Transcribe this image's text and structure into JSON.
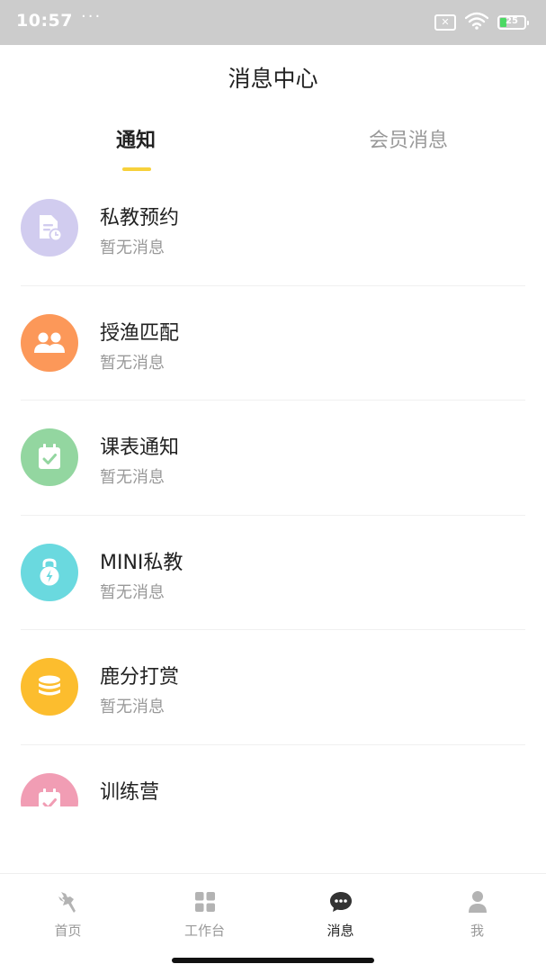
{
  "status_bar": {
    "time": "10:57",
    "dots": "···",
    "battery_level": "25"
  },
  "header": {
    "title": "消息中心"
  },
  "tabs": [
    {
      "label": "通知",
      "active": true
    },
    {
      "label": "会员消息",
      "active": false
    }
  ],
  "messages": [
    {
      "title": "私教预约",
      "subtitle": "暂无消息",
      "icon": "document-clock-icon",
      "color": "#d1ccef"
    },
    {
      "title": "授渔匹配",
      "subtitle": "暂无消息",
      "icon": "users-icon",
      "color": "#fc9859"
    },
    {
      "title": "课表通知",
      "subtitle": "暂无消息",
      "icon": "calendar-check-icon",
      "color": "#93d6a0"
    },
    {
      "title": "MINI私教",
      "subtitle": "暂无消息",
      "icon": "kettlebell-icon",
      "color": "#6ad9df"
    },
    {
      "title": "鹿分打赏",
      "subtitle": "暂无消息",
      "icon": "coin-stack-icon",
      "color": "#fcbd2e"
    },
    {
      "title": "训练营",
      "subtitle": "",
      "icon": "calendar-icon",
      "color": "#f19db4"
    }
  ],
  "bottom_nav": [
    {
      "label": "首页",
      "icon": "deer-icon",
      "active": false
    },
    {
      "label": "工作台",
      "icon": "grid-icon",
      "active": false
    },
    {
      "label": "消息",
      "icon": "chat-bubble-icon",
      "active": true
    },
    {
      "label": "我",
      "icon": "person-icon",
      "active": false
    }
  ]
}
